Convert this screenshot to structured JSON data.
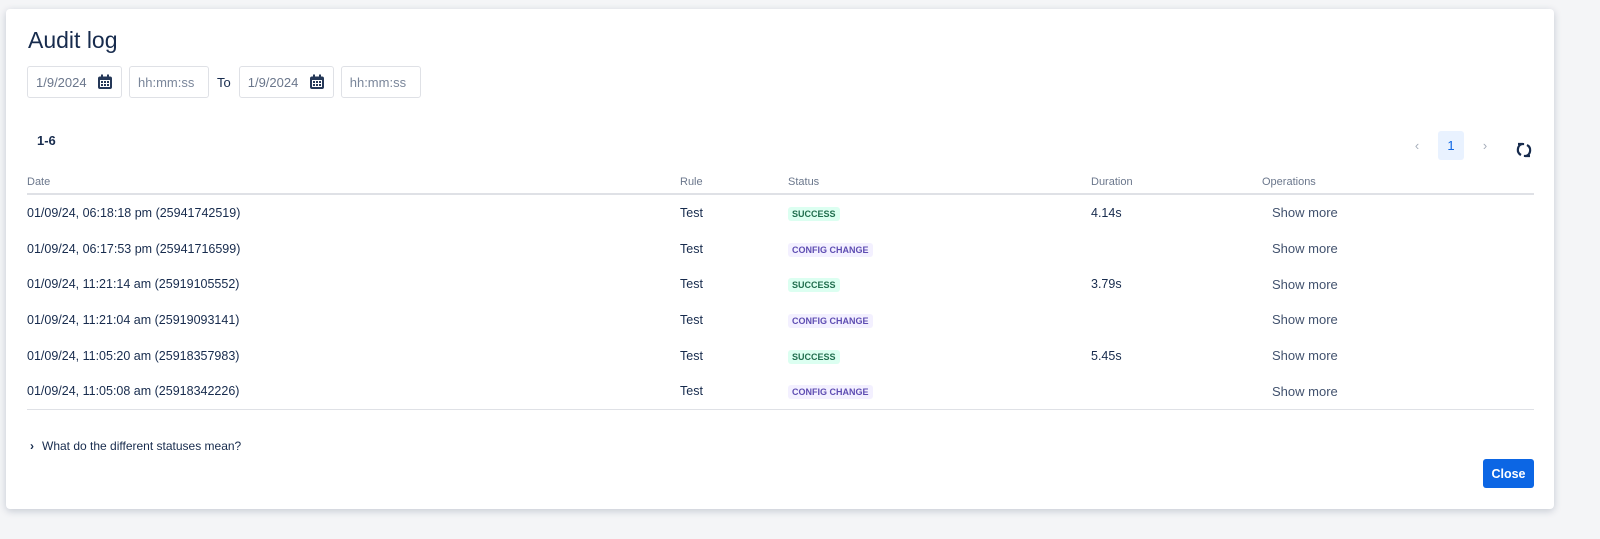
{
  "title": "Audit log",
  "filters": {
    "from_date": "1/9/2024",
    "from_time_placeholder": "hh:mm:ss",
    "to_label": "To",
    "to_date": "1/9/2024",
    "to_time_placeholder": "hh:mm:ss"
  },
  "range": "1-6",
  "pagination": {
    "current": "1"
  },
  "columns": [
    "Date",
    "Rule",
    "Status",
    "Duration",
    "Operations"
  ],
  "rows": [
    {
      "date": "01/09/24, 06:18:18 pm (25941742519)",
      "rule": "Test",
      "status": "SUCCESS",
      "duration": "4.14s",
      "op": "Show more"
    },
    {
      "date": "01/09/24, 06:17:53 pm (25941716599)",
      "rule": "Test",
      "status": "CONFIG CHANGE",
      "duration": "",
      "op": "Show more"
    },
    {
      "date": "01/09/24, 11:21:14 am (25919105552)",
      "rule": "Test",
      "status": "SUCCESS",
      "duration": "3.79s",
      "op": "Show more"
    },
    {
      "date": "01/09/24, 11:21:04 am (25919093141)",
      "rule": "Test",
      "status": "CONFIG CHANGE",
      "duration": "",
      "op": "Show more"
    },
    {
      "date": "01/09/24, 11:05:20 am (25918357983)",
      "rule": "Test",
      "status": "SUCCESS",
      "duration": "5.45s",
      "op": "Show more"
    },
    {
      "date": "01/09/24, 11:05:08 am (25918342226)",
      "rule": "Test",
      "status": "CONFIG CHANGE",
      "duration": "",
      "op": "Show more"
    }
  ],
  "faq": "What do the different statuses mean?",
  "close_label": "Close"
}
